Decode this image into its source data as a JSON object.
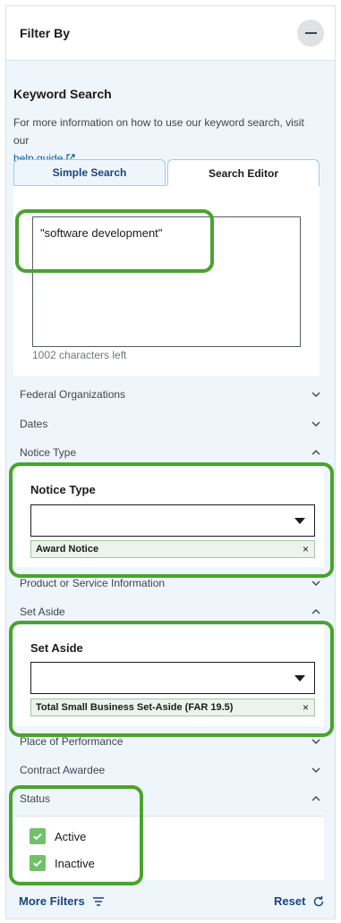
{
  "header": {
    "title": "Filter By"
  },
  "keyword": {
    "title": "Keyword Search",
    "desc": "For more information on how to use our keyword search, visit our",
    "help_link": "help guide",
    "tabs": [
      {
        "label": "Simple Search",
        "active": false
      },
      {
        "label": "Search Editor",
        "active": true
      }
    ],
    "editor_value": "\"software development\"",
    "chars_left": "1002 characters left"
  },
  "accordion": {
    "federal_orgs": "Federal Organizations",
    "dates": "Dates",
    "notice_type": "Notice Type",
    "product_service": "Product or Service Information",
    "set_aside": "Set Aside",
    "place_of_performance": "Place of Performance",
    "contract_awardee": "Contract Awardee",
    "status": "Status"
  },
  "notice_type": {
    "title": "Notice Type",
    "selected": "Award Notice"
  },
  "set_aside": {
    "title": "Set Aside",
    "selected": "Total Small Business Set-Aside (FAR 19.5)"
  },
  "status": {
    "options": [
      {
        "label": "Active",
        "checked": true
      },
      {
        "label": "Inactive",
        "checked": true
      }
    ]
  },
  "footer": {
    "more_filters": "More Filters",
    "reset": "Reset"
  },
  "colors": {
    "highlight": "#4aa32c",
    "checkbox": "#70c16a",
    "link": "#005ea2",
    "chip_bg": "#ecf3ec"
  }
}
